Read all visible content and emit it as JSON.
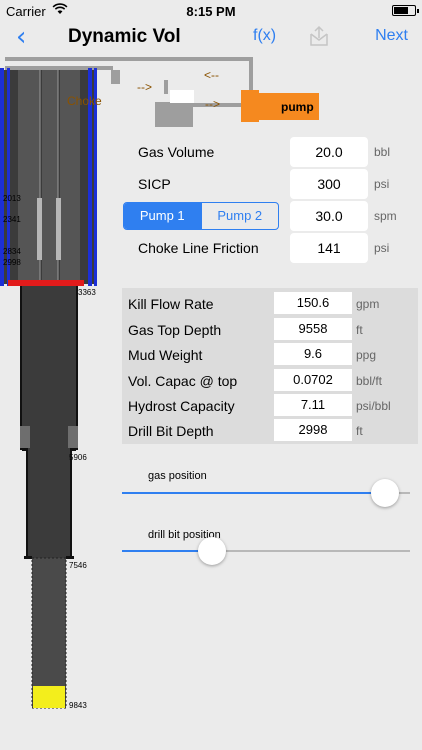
{
  "status_bar": {
    "carrier": "Carrier",
    "time": "8:15 PM"
  },
  "nav": {
    "back_glyph": "‹",
    "title": "Dynamic Vol",
    "fx_label": "f(x)",
    "next_label": "Next",
    "action_icon": "share-icon"
  },
  "schematic": {
    "choke_label": "Choke",
    "arrow_top": "<--",
    "arrow_mid": "-->",
    "arrow_choke": "-->",
    "pump_label": "pump",
    "depths": [
      "2013",
      "2341",
      "2834",
      "2998",
      "3363",
      "5906",
      "7546",
      "9843"
    ]
  },
  "inputs": {
    "gas_volume": {
      "label": "Gas Volume",
      "value": "20.0",
      "unit": "bbl"
    },
    "sicp": {
      "label": "SICP",
      "value": "300",
      "unit": "psi"
    },
    "pump": {
      "options": [
        "Pump 1",
        "Pump 2"
      ],
      "selected": "Pump 1",
      "value": "30.0",
      "unit": "spm"
    },
    "choke_line_friction": {
      "label": "Choke Line Friction",
      "value": "141",
      "unit": "psi"
    }
  },
  "calculated": [
    {
      "label": "Kill Flow Rate",
      "value": "150.6",
      "unit": "gpm"
    },
    {
      "label": "Gas Top Depth",
      "value": "9558",
      "unit": "ft"
    },
    {
      "label": "Mud Weight",
      "value": "9.6",
      "unit": "ppg"
    },
    {
      "label": "Vol. Capac @ top",
      "value": "0.0702",
      "unit": "bbl/ft"
    },
    {
      "label": "Hydrost Capacity",
      "value": "7.11",
      "unit": "psi/bbl"
    },
    {
      "label": "Drill Bit Depth",
      "value": "2998",
      "unit": "ft"
    }
  ],
  "sliders": {
    "gas_position": {
      "label": "gas position",
      "fraction": 0.96
    },
    "drill_bit_position": {
      "label": "drill bit position",
      "fraction": 0.33
    }
  },
  "colors": {
    "accent": "#2f7ff0",
    "pump": "#f5891f",
    "bop_blue": "#1c2fd6",
    "red_band": "#e21b1b",
    "gas_yellow": "#f3ee1c"
  }
}
